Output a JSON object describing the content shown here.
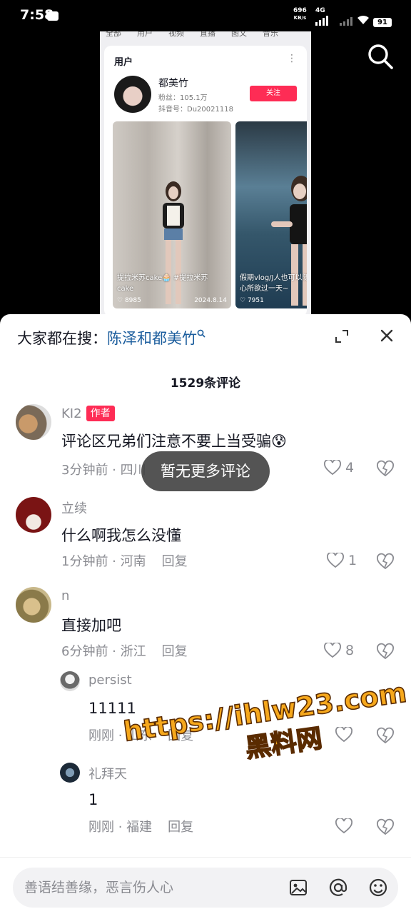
{
  "status_bar": {
    "time": "7:58",
    "net_speed": "696",
    "net_unit": "KB/s",
    "network": "4G",
    "battery": "91"
  },
  "card": {
    "tabs": [
      "全部",
      "用户",
      "视频",
      "直播",
      "图文",
      "音乐"
    ],
    "section_label": "用户",
    "more_icon": "⋮",
    "user_name": "都美竹",
    "fans": "粉丝：105.1万",
    "douyin_id": "抖音号：Du20021118",
    "follow_label": "关注",
    "videos": [
      {
        "title": "提拉米苏cake🧁 #提拉米苏cake",
        "likes": "8985",
        "date": "2024.8.14"
      },
      {
        "title": "假期vlog/J人也可以随心所欲过一天~",
        "likes": "7951",
        "date": ""
      }
    ]
  },
  "sheet": {
    "trend_prefix": "大家都在搜：",
    "trend_keyword": "陈泽和都美竹",
    "comment_count": "1529条评论",
    "toast": "暂无更多评论",
    "reply_label": "回复",
    "comments": [
      {
        "name": "KI2",
        "badge": "作者",
        "text": "评论区兄弟们注意不要上当受骗😰",
        "meta": "3分钟前 · 四川",
        "likes": "4"
      },
      {
        "name": "立续",
        "text": "什么啊我怎么没懂",
        "meta": "1分钟前 · 河南",
        "likes": "1"
      },
      {
        "name": "n",
        "text": "直接加吧",
        "meta": "6分钟前 · 浙江",
        "likes": "8"
      }
    ],
    "replies": [
      {
        "name": "persist",
        "text": "11111",
        "meta": "刚刚 · 山东"
      },
      {
        "name": "礼拜天",
        "text": "1",
        "meta": "刚刚 · 福建"
      }
    ],
    "input_placeholder": "善语结善缘，恶言伤人心"
  },
  "watermark": {
    "line1": "https://ihlw23.com",
    "line2": "黑料网"
  },
  "colors": {
    "accent": "#fe2c55",
    "keyword_blue": "#1b5d9d",
    "secondary_text": "#8a8b91",
    "watermark_fill": "#f6a81c"
  }
}
